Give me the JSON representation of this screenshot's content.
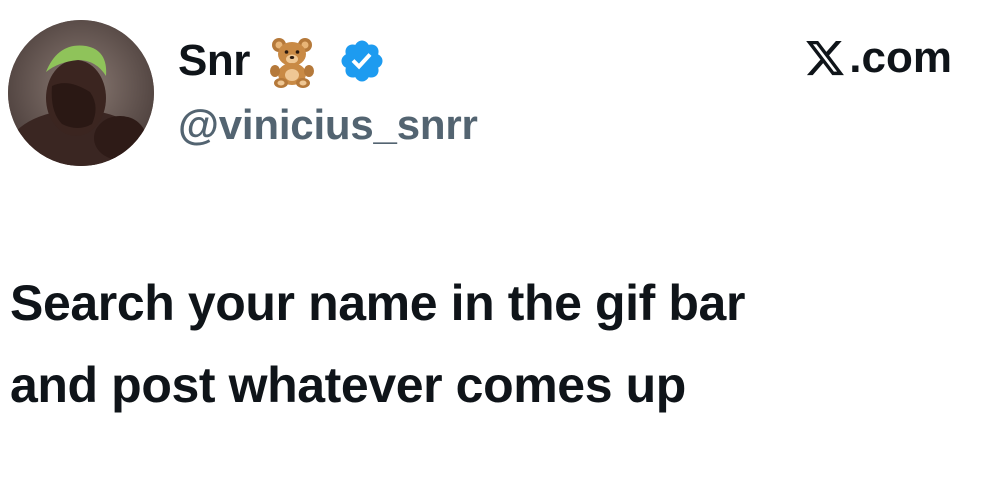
{
  "author": {
    "display_name": "Snr",
    "handle": "@vinicius_snrr",
    "name_emoji": "teddy-bear-icon",
    "verified_badge": "verified-icon",
    "verified_color": "#1d9bf0"
  },
  "source": {
    "site_suffix": ".com",
    "logo": "x-logo-icon"
  },
  "post": {
    "line1": "Search your name in the gif bar",
    "line2": "and post whatever comes up"
  },
  "colors": {
    "text": "#0f1419",
    "handle": "#536471",
    "background": "#ffffff"
  }
}
